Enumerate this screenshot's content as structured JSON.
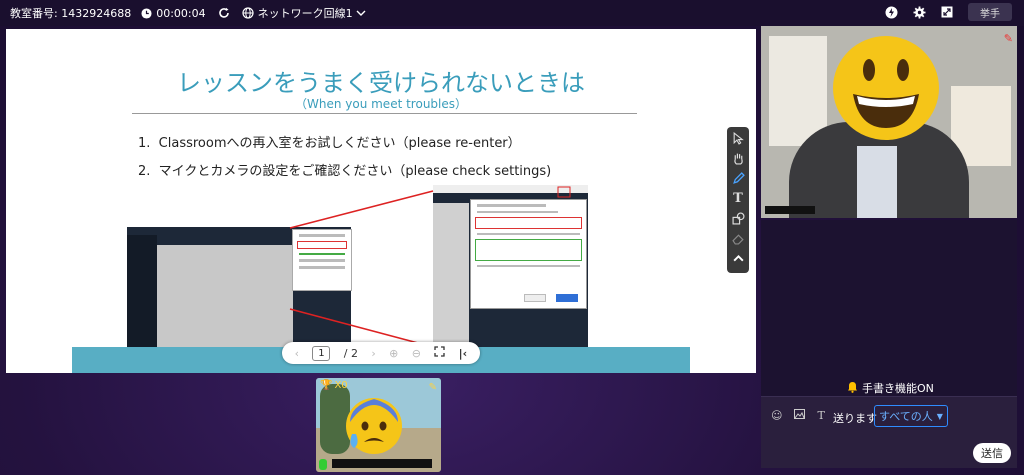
{
  "topbar": {
    "room_label": "教室番号: 1432924688",
    "timer": "00:00:04",
    "network": "ネットワーク回線1",
    "raise_hand": "挙手"
  },
  "slide": {
    "title": "レッスンをうまく受けられないときは",
    "subtitle": "（When you meet troubles）",
    "items": [
      "1.  Classroomへの再入室をお試しください（please re-enter）",
      "2.  マイクとカメラの設定をご確認ください（please check settings)"
    ]
  },
  "pager": {
    "current": "1",
    "total": "/ 2"
  },
  "chat": {
    "notice": "手書き機能ON",
    "send_label": "送ります",
    "recipient": "すべての人",
    "send_button": "送信"
  },
  "student": {
    "score": "X0"
  },
  "colors": {
    "accent": "#2f8cff",
    "slide_title": "#3a9dbb",
    "band": "#58aec4"
  }
}
